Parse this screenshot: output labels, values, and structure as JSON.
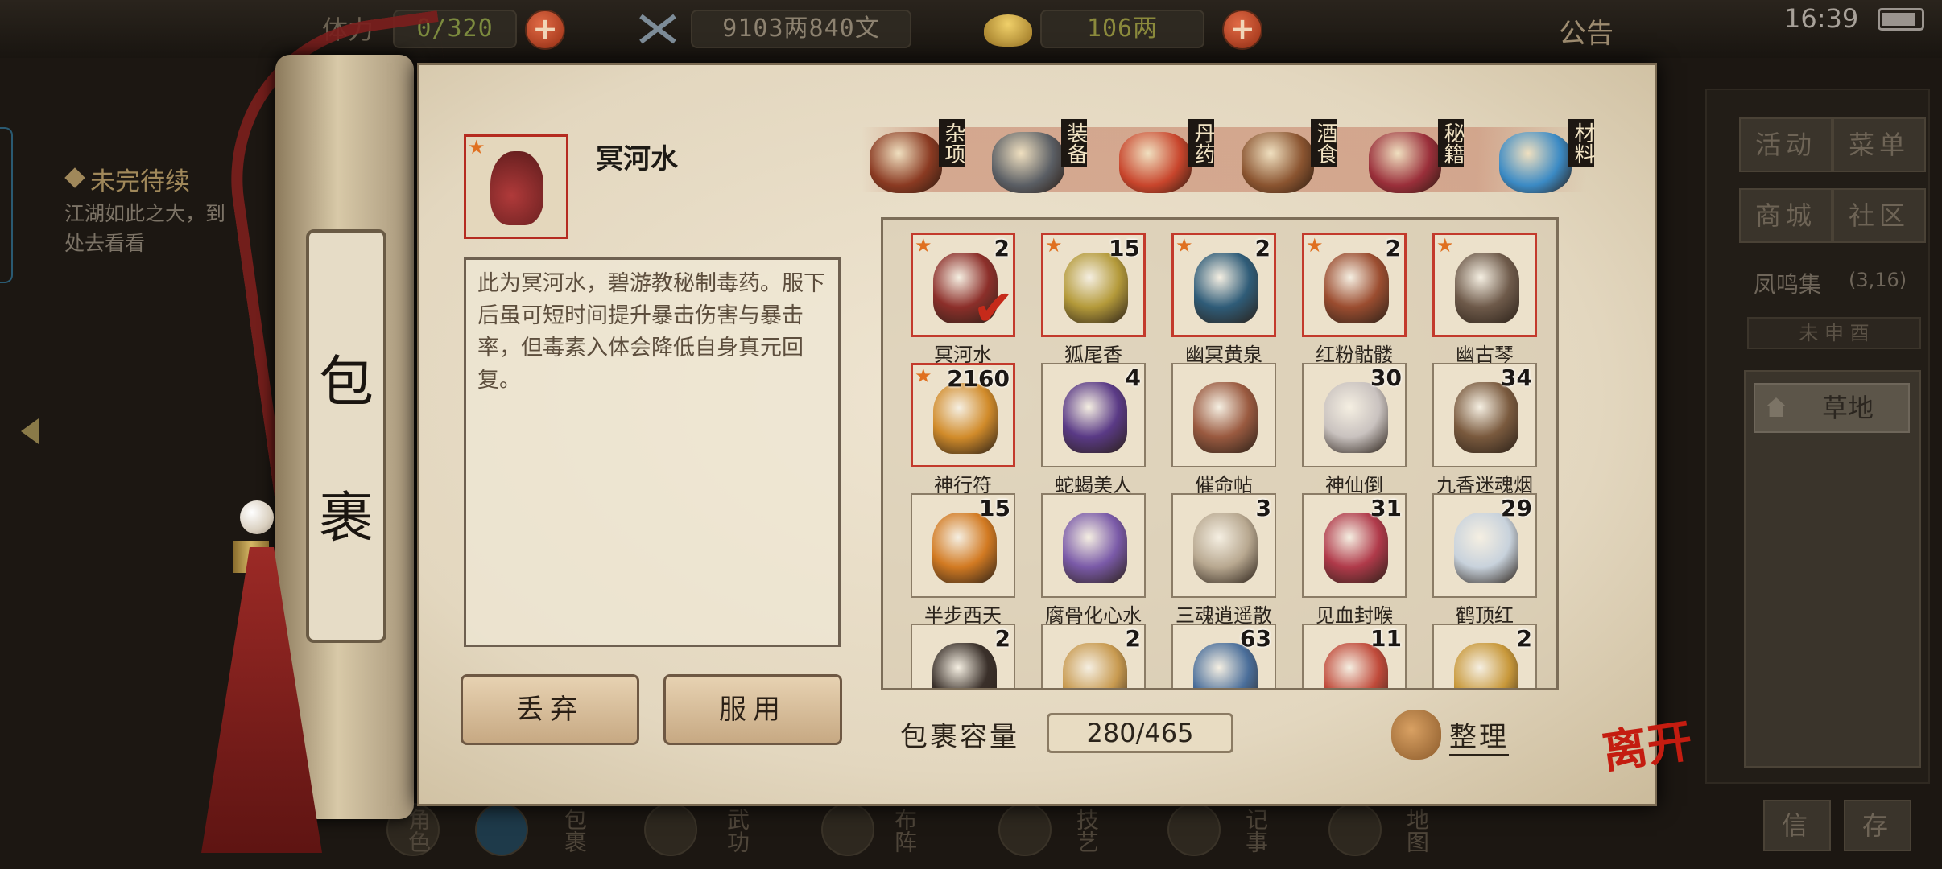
{
  "topbar": {
    "resource_label": "体力",
    "resource_value": "0/320",
    "money": "9103两840文",
    "gold": "106两",
    "notice": "公告",
    "time": "16:39"
  },
  "quest": {
    "title": "未完待续",
    "text_line1": "江湖如此之大，到",
    "text_line2": "处去看看"
  },
  "side": {
    "buttons": [
      "活动",
      "菜单",
      "商城",
      "社区"
    ],
    "location": "凤鸣集",
    "coords": "(3,16)",
    "time_row": "未 申 酉",
    "place": "草地",
    "bottom_buttons": [
      "信",
      "存"
    ]
  },
  "bottom_nav": [
    "角色",
    "包裹",
    "武功",
    "布阵",
    "技艺",
    "记事",
    "地图"
  ],
  "scroll_title": [
    "包",
    "裹"
  ],
  "selected": {
    "name": "冥河水",
    "description": "此为冥河水，碧游教秘制毒药。服下后虽可短时间提升暴击伤害与暴击率，但毒素入体会降低自身真元回复。",
    "rare_mark": "★"
  },
  "actions": {
    "discard": "丢弃",
    "use": "服用"
  },
  "tabs": [
    {
      "label": "杂项",
      "color": "#8a3a22"
    },
    {
      "label": "装备",
      "color": "#5a5e64"
    },
    {
      "label": "丹药",
      "color": "#c8452c"
    },
    {
      "label": "酒食",
      "color": "#8a5430"
    },
    {
      "label": "秘籍",
      "color": "#9a2f3a"
    },
    {
      "label": "材料",
      "color": "#3b8ac4"
    }
  ],
  "items": [
    {
      "name": "冥河水",
      "count": "2",
      "rare": true,
      "color": "#8c2f2a"
    },
    {
      "name": "狐尾香",
      "count": "15",
      "rare": true,
      "color": "#b49a3a"
    },
    {
      "name": "幽冥黄泉",
      "count": "2",
      "rare": true,
      "color": "#2f5c78"
    },
    {
      "name": "红粉骷髅",
      "count": "2",
      "rare": true,
      "color": "#9b4d30"
    },
    {
      "name": "幽古琴",
      "count": "",
      "rare": true,
      "color": "#6e5a4a"
    },
    {
      "name": "神行符",
      "count": "2160",
      "rare": true,
      "color": "#d18b2a"
    },
    {
      "name": "蛇蝎美人",
      "count": "4",
      "rare": false,
      "color": "#5a3a86"
    },
    {
      "name": "催命帖",
      "count": "",
      "rare": false,
      "color": "#9a5a40"
    },
    {
      "name": "神仙倒",
      "count": "30",
      "rare": false,
      "color": "#c9c2bf"
    },
    {
      "name": "九香迷魂烟",
      "count": "34",
      "rare": false,
      "color": "#7a5a3e"
    },
    {
      "name": "半步西天",
      "count": "15",
      "rare": false,
      "color": "#d27a22"
    },
    {
      "name": "腐骨化心水",
      "count": "",
      "rare": false,
      "color": "#7a5aa8"
    },
    {
      "name": "三魂逍遥散",
      "count": "3",
      "rare": false,
      "color": "#b8a890"
    },
    {
      "name": "见血封喉",
      "count": "31",
      "rare": false,
      "color": "#b03a4a"
    },
    {
      "name": "鹤顶红",
      "count": "29",
      "rare": false,
      "color": "#c8d2dc"
    },
    {
      "name": "",
      "count": "2",
      "rare": false,
      "color": "#3a302a"
    },
    {
      "name": "",
      "count": "2",
      "rare": false,
      "color": "#c89a50"
    },
    {
      "name": "",
      "count": "63",
      "rare": false,
      "color": "#4a6e9a"
    },
    {
      "name": "",
      "count": "11",
      "rare": false,
      "color": "#c04a3a"
    },
    {
      "name": "",
      "count": "2",
      "rare": false,
      "color": "#c8983a"
    }
  ],
  "capacity": {
    "label": "包裹容量",
    "value": "280/465"
  },
  "sort_label": "整理",
  "leave_label": "离开"
}
